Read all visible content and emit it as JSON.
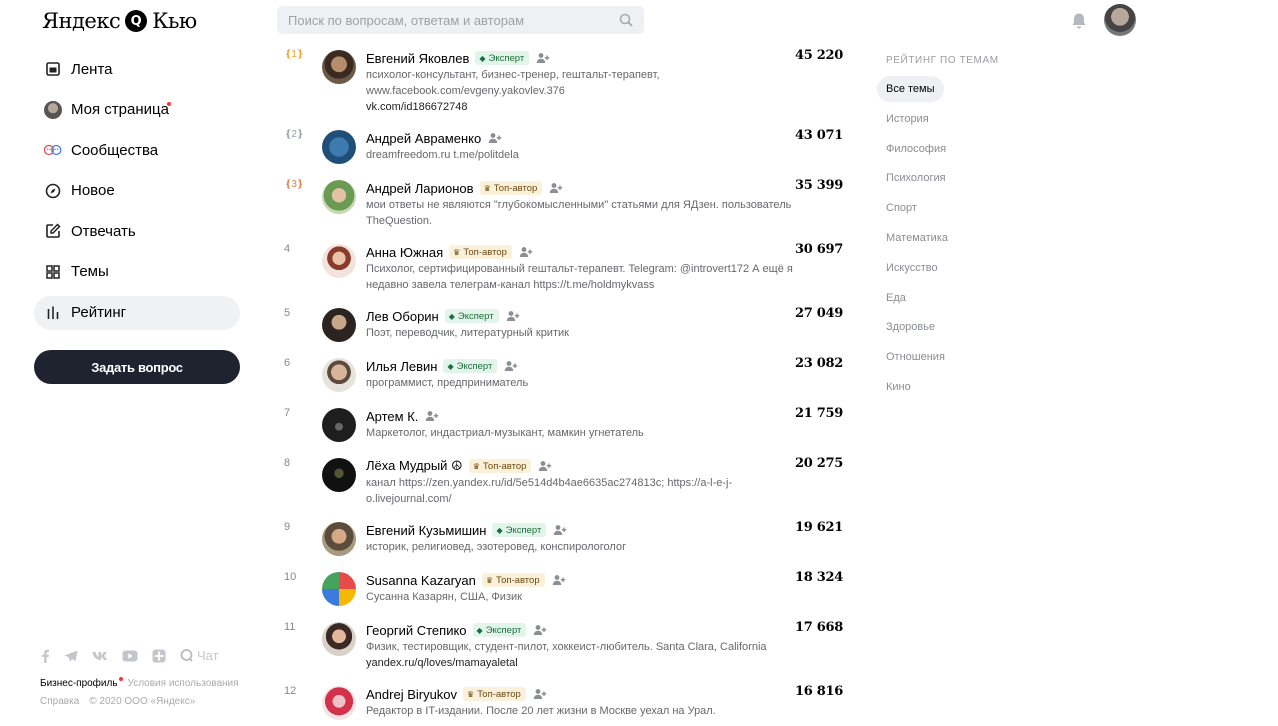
{
  "header": {
    "logo_part1": "Яндекс",
    "logo_mark": "Q",
    "logo_part2": "Кью",
    "search_placeholder": "Поиск по вопросам, ответам и авторам"
  },
  "nav": {
    "items": [
      {
        "label": "Лента",
        "icon": "feed-icon"
      },
      {
        "label": "Моя страница",
        "icon": "user-avatar-icon"
      },
      {
        "label": "Сообщества",
        "icon": "communities-icon"
      },
      {
        "label": "Новое",
        "icon": "compass-icon"
      },
      {
        "label": "Отвечать",
        "icon": "edit-icon"
      },
      {
        "label": "Темы",
        "icon": "grid-icon"
      },
      {
        "label": "Рейтинг",
        "icon": "rating-icon"
      }
    ],
    "ask_button": "Задать вопрос"
  },
  "footer": {
    "chat": "Чат",
    "business": "Бизнес-профиль",
    "terms": "Условия использования",
    "help": "Справка",
    "copyright": "© 2020 ООО «Яндекс»"
  },
  "rating": {
    "rows": [
      {
        "rank": "1",
        "name": "Евгений Яковлев",
        "badge": "Эксперт",
        "badge_type": "expert",
        "desc": "психолог-консультант, бизнес-тренер, гештальт-терапевт, www.facebook.com/evgeny.yakovlev.376",
        "link": "vk.com/id186672748",
        "score": "45 220"
      },
      {
        "rank": "2",
        "name": "Андрей Авраменко",
        "badge": "",
        "badge_type": "",
        "desc": "dreamfreedom.ru t.me/politdela",
        "link": "",
        "score": "43 071"
      },
      {
        "rank": "3",
        "name": "Андрей Ларионов",
        "badge": "Топ-автор",
        "badge_type": "top",
        "desc": "мои ответы не являются \"глубокомысленными\" статьями для ЯДзен. пользователь TheQuestion.",
        "link": "",
        "score": "35 399"
      },
      {
        "rank": "4",
        "name": "Анна Южная",
        "badge": "Топ-автор",
        "badge_type": "top",
        "desc": "Психолог, сертифицированный гештальт-терапевт. Telegram: @introvert172 А ещё я недавно завела телеграм-канал https://t.me/holdmykvass",
        "link": "",
        "score": "30 697"
      },
      {
        "rank": "5",
        "name": "Лев Оборин",
        "badge": "Эксперт",
        "badge_type": "expert",
        "desc": "Поэт, переводчик, литературный критик",
        "link": "",
        "score": "27 049"
      },
      {
        "rank": "6",
        "name": "Илья Левин",
        "badge": "Эксперт",
        "badge_type": "expert",
        "desc": "программист, предприниматель",
        "link": "",
        "score": "23 082"
      },
      {
        "rank": "7",
        "name": "Артем К.",
        "badge": "",
        "badge_type": "",
        "desc": "Маркетолог, индастриал-музыкант, мамкин угнетатель",
        "link": "",
        "score": "21 759"
      },
      {
        "rank": "8",
        "name": "Лёха Мудрый ☮",
        "badge": "Топ-автор",
        "badge_type": "top",
        "desc": "канал https://zen.yandex.ru/id/5e514d4b4ae6635ac274813c; https://a-l-e-j-o.livejournal.com/",
        "link": "",
        "score": "20 275"
      },
      {
        "rank": "9",
        "name": "Евгений Кузьмишин",
        "badge": "Эксперт",
        "badge_type": "expert",
        "desc": "историк, религиовед, эзотеровед, конспирологолог",
        "link": "",
        "score": "19 621"
      },
      {
        "rank": "10",
        "name": "Susanna Kazaryan",
        "badge": "Топ-автор",
        "badge_type": "top",
        "desc": "Сусанна Казарян, США, Физик",
        "link": "",
        "score": "18 324"
      },
      {
        "rank": "11",
        "name": "Георгий Степико",
        "badge": "Эксперт",
        "badge_type": "expert",
        "desc": "Физик, тестировщик, студент-пилот, хоккеист-любитель. Santa Clara, California",
        "link": "yandex.ru/q/loves/mamayaletal",
        "score": "17 668"
      },
      {
        "rank": "12",
        "name": "Andrej Biryukov",
        "badge": "Топ-автор",
        "badge_type": "top",
        "desc": "Редактор в IT-издании. После 20 лет жизни в Москве уехал на Урал.",
        "link": "",
        "score": "16 816"
      }
    ]
  },
  "topics": {
    "title": "РЕЙТИНГ ПО ТЕМАМ",
    "items": [
      "Все темы",
      "История",
      "Философия",
      "Психология",
      "Спорт",
      "Математика",
      "Искусство",
      "Еда",
      "Здоровье",
      "Отношения",
      "Кино"
    ],
    "active": "Все темы"
  },
  "colors": {
    "ask_button_bg": "#1f2330",
    "expert_badge_bg": "#e3f5ea",
    "top_badge_bg": "#fbf0da",
    "gold": "#e5a534",
    "notification_dot": "#ff3333"
  }
}
